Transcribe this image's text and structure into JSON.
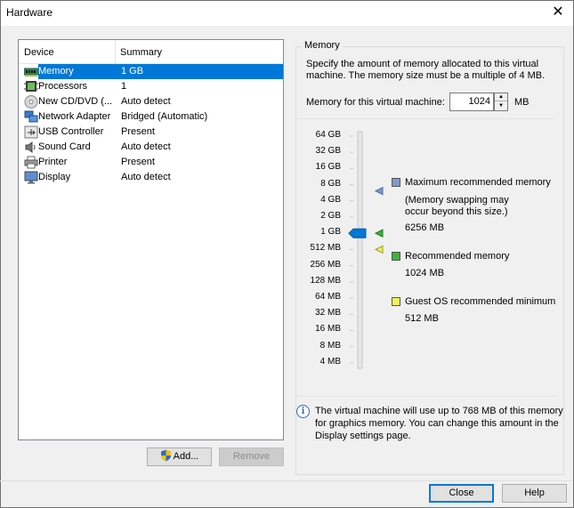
{
  "window": {
    "title": "Hardware",
    "close_glyph": "✕"
  },
  "device_list": {
    "columns": [
      "Device",
      "Summary"
    ],
    "items": [
      {
        "name": "Memory",
        "summary": "1 GB",
        "icon": "memory-icon",
        "selected": true
      },
      {
        "name": "Processors",
        "summary": "1",
        "icon": "processor-icon"
      },
      {
        "name": "New CD/DVD (...",
        "summary": "Auto detect",
        "icon": "cd-dvd-icon"
      },
      {
        "name": "Network Adapter",
        "summary": "Bridged (Automatic)",
        "icon": "network-adapter-icon"
      },
      {
        "name": "USB Controller",
        "summary": "Present",
        "icon": "usb-icon"
      },
      {
        "name": "Sound Card",
        "summary": "Auto detect",
        "icon": "sound-card-icon"
      },
      {
        "name": "Printer",
        "summary": "Present",
        "icon": "printer-icon"
      },
      {
        "name": "Display",
        "summary": "Auto detect",
        "icon": "display-icon"
      }
    ],
    "add_label": "Add...",
    "remove_label": "Remove"
  },
  "memory": {
    "group_label": "Memory",
    "description": "Specify the amount of memory allocated to this virtual machine. The memory size must be a multiple of 4 MB.",
    "input_label": "Memory for this virtual machine:",
    "value": "1024",
    "unit": "MB",
    "scale": [
      "64 GB",
      "32 GB",
      "16 GB",
      "8 GB",
      "4 GB",
      "2 GB",
      "1 GB",
      "512 MB",
      "256 MB",
      "128 MB",
      "64 MB",
      "32 MB",
      "16 MB",
      "8 MB",
      "4 MB"
    ],
    "slider_value": "1 GB",
    "legend": {
      "max_title": "Maximum recommended memory",
      "max_note": "(Memory swapping may occur beyond this size.)",
      "max_value": "6256 MB",
      "rec_title": "Recommended memory",
      "rec_value": "1024 MB",
      "min_title": "Guest OS recommended minimum",
      "min_value": "512 MB"
    },
    "colors": {
      "max": "#7f9cc9",
      "rec": "#3cb43c",
      "min": "#f2f05a",
      "thumb": "#0078d7"
    },
    "info_text": "The virtual machine will use up to 768 MB of this memory for graphics memory. You can change this amount in the Display settings page."
  },
  "buttons": {
    "close": "Close",
    "help": "Help"
  }
}
